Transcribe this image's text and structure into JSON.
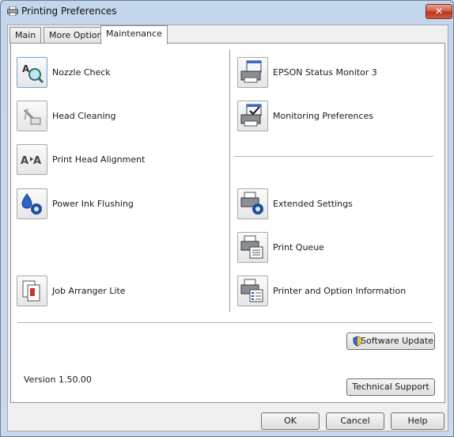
{
  "window": {
    "title": "Printing Preferences",
    "close_label": "✕"
  },
  "tabs": [
    {
      "label": "Main"
    },
    {
      "label": "More Options"
    },
    {
      "label": "Maintenance"
    }
  ],
  "left_items": [
    {
      "label": "Nozzle Check",
      "icon": "nozzle-check-icon"
    },
    {
      "label": "Head Cleaning",
      "icon": "head-cleaning-icon"
    },
    {
      "label": "Print Head Alignment",
      "icon": "head-alignment-icon"
    },
    {
      "label": "Power Ink Flushing",
      "icon": "ink-flushing-icon"
    },
    {
      "label": "Job Arranger Lite",
      "icon": "job-arranger-icon"
    }
  ],
  "right_items": [
    {
      "label": "EPSON Status Monitor 3",
      "icon": "status-monitor-icon"
    },
    {
      "label": "Monitoring Preferences",
      "icon": "monitoring-preferences-icon"
    },
    {
      "label": "Extended Settings",
      "icon": "extended-settings-icon"
    },
    {
      "label": "Print Queue",
      "icon": "print-queue-icon"
    },
    {
      "label": "Printer and Option Information",
      "icon": "printer-info-icon"
    }
  ],
  "software_update_label": "Software Update",
  "technical_support_label": "Technical Support",
  "version_text": "Version 1.50.00",
  "buttons": {
    "ok": "OK",
    "cancel": "Cancel",
    "help": "Help"
  },
  "colors": {
    "titlebar": "#c4d6ec",
    "close": "#c94a33",
    "panel": "#ffffff"
  }
}
